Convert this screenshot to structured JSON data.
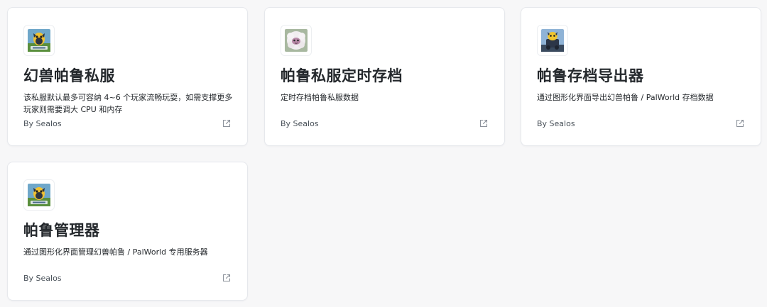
{
  "cards": [
    {
      "title": "幻兽帕鲁私服",
      "description": "该私服默认最多可容纳 4~6 个玩家流畅玩耍，如需支撑更多玩家则需要调大 CPU 和内存",
      "author": "By Sealos",
      "logo_icon": "palworld-logo-icon"
    },
    {
      "title": "帕鲁私服定时存档",
      "description": "定时存档帕鲁私服数据",
      "author": "By Sealos",
      "logo_icon": "sheep-pal-icon"
    },
    {
      "title": "帕鲁存档导出器",
      "description": "通过图形化界面导出幻兽帕鲁 / PalWorld 存档数据",
      "author": "By Sealos",
      "logo_icon": "pal-mech-icon"
    },
    {
      "title": "帕鲁管理器",
      "description": "通过图形化界面管理幻兽帕鲁 / PalWorld 专用服务器",
      "author": "By Sealos",
      "logo_icon": "palworld-logo-icon"
    }
  ]
}
